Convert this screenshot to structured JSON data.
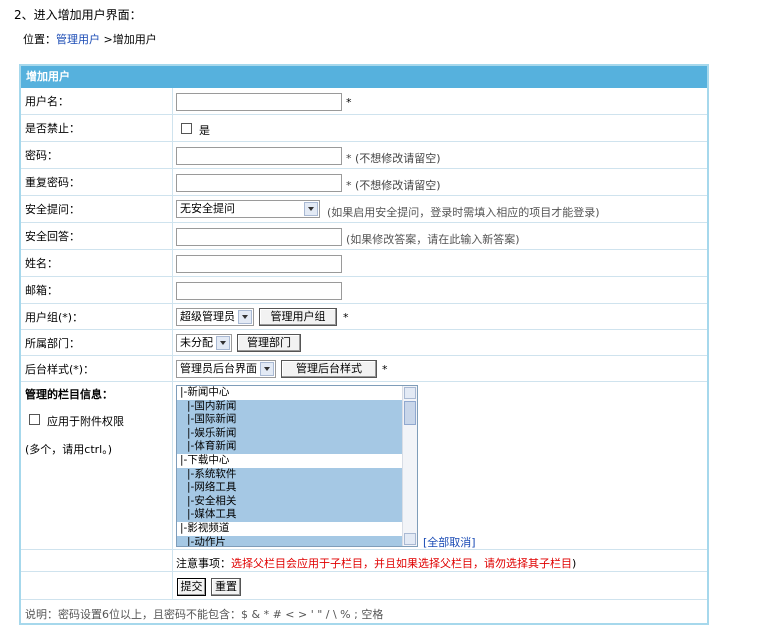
{
  "step_title": "2、进入增加用户界面：",
  "location": {
    "prefix": "位置：",
    "link": "管理用户",
    "current": " >增加用户"
  },
  "panel_title": "增加用户",
  "fields": {
    "username": {
      "label": "用户名：",
      "value": "",
      "required": "*"
    },
    "disabled": {
      "label": "是否禁止：",
      "checkbox_label": "是"
    },
    "password": {
      "label": "密码：",
      "value": "",
      "note": "* (不想修改请留空)"
    },
    "password_repeat": {
      "label": "重复密码：",
      "value": "",
      "note": "* (不想修改请留空)"
    },
    "security_question": {
      "label": "安全提问：",
      "selected": "无安全提问",
      "note": "(如果启用安全提问，登录时需填入相应的项目才能登录)"
    },
    "security_answer": {
      "label": "安全回答：",
      "value": "",
      "note": "(如果修改答案，请在此输入新答案)"
    },
    "name": {
      "label": "姓名：",
      "value": ""
    },
    "email": {
      "label": "邮箱：",
      "value": ""
    },
    "user_group": {
      "label": "用户组(*)：",
      "selected": "超级管理员",
      "button": "管理用户组",
      "required": "*"
    },
    "department": {
      "label": "所属部门：",
      "selected": "未分配",
      "button": "管理部门"
    },
    "admin_style": {
      "label": "后台样式(*)：",
      "selected": "管理员后台界面",
      "button": "管理后台样式",
      "required": "*"
    },
    "columns": {
      "label": "管理的栏目信息：",
      "attachment_checkbox": "应用于附件权限",
      "multi_hint": "(多个，请用ctrl。)",
      "items": [
        {
          "text": "|-新闻中心",
          "selected": false
        },
        {
          "text": "|-国内新闻",
          "selected": true
        },
        {
          "text": "|-国际新闻",
          "selected": true
        },
        {
          "text": "|-娱乐新闻",
          "selected": true
        },
        {
          "text": "|-体育新闻",
          "selected": true
        },
        {
          "text": "|-下载中心",
          "selected": false
        },
        {
          "text": "|-系统软件",
          "selected": true
        },
        {
          "text": "|-网络工具",
          "selected": true
        },
        {
          "text": "|-安全相关",
          "selected": true
        },
        {
          "text": "|-媒体工具",
          "selected": true
        },
        {
          "text": "|-影视频道",
          "selected": false
        },
        {
          "text": "|-动作片",
          "selected": true
        }
      ],
      "cancel_all": "[全部取消]"
    }
  },
  "notice": {
    "prefix": "注意事项：",
    "text": "选择父栏目会应用于子栏目，并且如果选择父栏目，请勿选择其子栏目",
    "suffix": ")"
  },
  "buttons": {
    "submit": "提交",
    "reset": "重置"
  },
  "footer": "说明：密码设置6位以上，且密码不能包含：$ & * # < > ' \" / \\ % ; 空格"
}
